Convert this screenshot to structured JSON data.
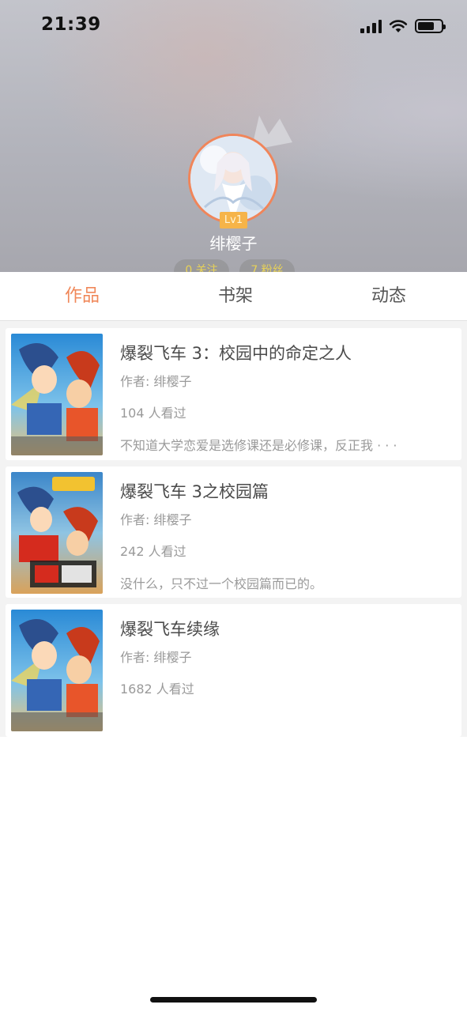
{
  "status_bar": {
    "time": "21:39"
  },
  "profile": {
    "username": "绯樱子",
    "level": "Lv1",
    "follow_stat": "0 关注",
    "fans_stat": "7 粉丝"
  },
  "tabs": [
    {
      "label": "作品",
      "active": true
    },
    {
      "label": "书架",
      "active": false
    },
    {
      "label": "动态",
      "active": false
    }
  ],
  "works": [
    {
      "title": "爆裂飞车 3：校园中的命定之人",
      "author": "作者: 绯樱子",
      "views": "104 人看过",
      "summary": "不知道大学恋爱是选修课还是必修课，反正我 · · ·"
    },
    {
      "title": "爆裂飞车 3之校园篇",
      "author": "作者: 绯樱子",
      "views": "242 人看过",
      "summary": "没什么，只不过一个校园篇而已的。"
    },
    {
      "title": "爆裂飞车续缘",
      "author": "作者: 绯樱子",
      "views": "1682 人看过",
      "summary": ""
    }
  ],
  "colors": {
    "accent": "#f0885a",
    "level_badge": "#f6b449",
    "stat_text": "#e8d257"
  }
}
